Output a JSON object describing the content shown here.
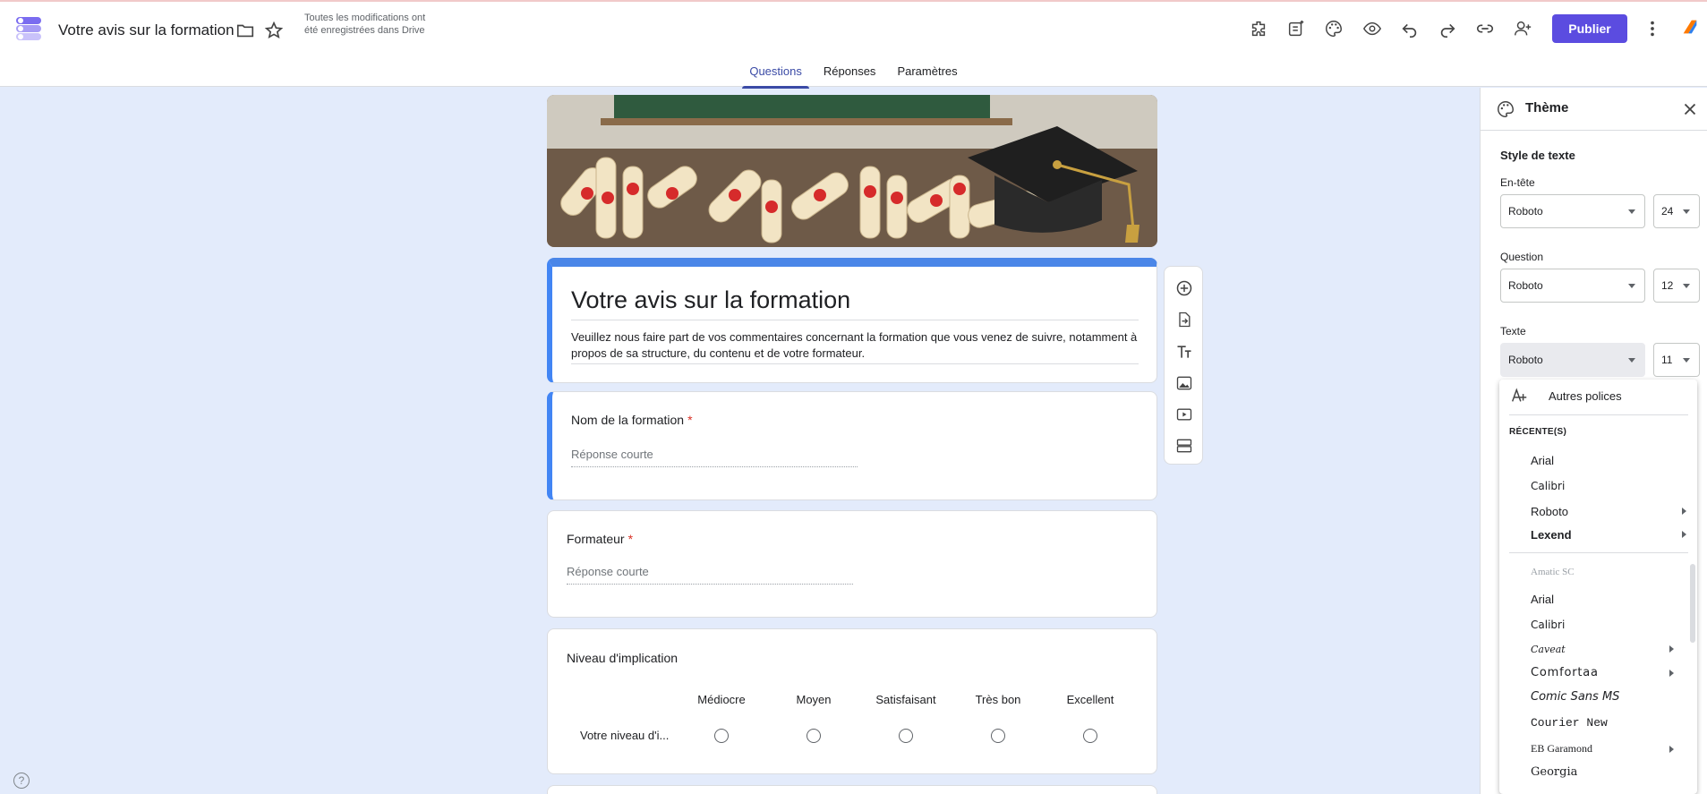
{
  "header": {
    "doc_title": "Votre avis sur la formation",
    "save_status": "Toutes les modifications ont été enregistrées dans Drive",
    "publish_label": "Publier",
    "icons": [
      "folder-icon",
      "star-icon",
      "addon-icon",
      "form-summary-icon",
      "palette-icon",
      "preview-icon",
      "undo-icon",
      "redo-icon",
      "link-icon",
      "add-collaborator-icon",
      "more-vert-icon"
    ]
  },
  "tabs": [
    {
      "label": "Questions",
      "active": true
    },
    {
      "label": "Réponses",
      "active": false
    },
    {
      "label": "Paramètres",
      "active": false
    }
  ],
  "form": {
    "title": "Votre avis sur la formation",
    "description": "Veuillez nous faire part de vos commentaires concernant la formation que vous venez de suivre, notamment à propos de sa structure, du contenu et de votre formateur.",
    "questions": [
      {
        "title": "Nom de la formation",
        "required": "*",
        "placeholder": "Réponse courte"
      },
      {
        "title": "Formateur",
        "required": "*",
        "placeholder": "Réponse courte"
      }
    ],
    "grid": {
      "title": "Niveau d'implication",
      "columns": [
        "Médiocre",
        "Moyen",
        "Satisfaisant",
        "Très bon",
        "Excellent"
      ],
      "rows": [
        "Votre niveau d'i..."
      ]
    }
  },
  "toolbar": [
    "add-question-icon",
    "import-questions-icon",
    "add-title-icon",
    "add-image-icon",
    "add-video-icon",
    "add-section-icon"
  ],
  "theme_panel": {
    "title": "Thème",
    "section": "Style de texte",
    "header": {
      "label": "En-tête",
      "font": "Roboto",
      "size": "24"
    },
    "question": {
      "label": "Question",
      "font": "Roboto",
      "size": "12"
    },
    "text": {
      "label": "Texte",
      "font": "Roboto",
      "size": "11"
    }
  },
  "font_dropdown": {
    "more_fonts": "Autres polices",
    "recent_label": "RÉCENTE(S)",
    "recent": [
      "Arial",
      "Calibri",
      "Roboto",
      "Lexend"
    ],
    "all": [
      "Amatic SC",
      "Arial",
      "Calibri",
      "Caveat",
      "Comfortaa",
      "Comic Sans MS",
      "Courier New",
      "EB Garamond",
      "Georgia"
    ]
  },
  "colors": {
    "accent": "#5b4ce0",
    "form_accent": "#4a86e8",
    "background": "#e3ebfb"
  }
}
